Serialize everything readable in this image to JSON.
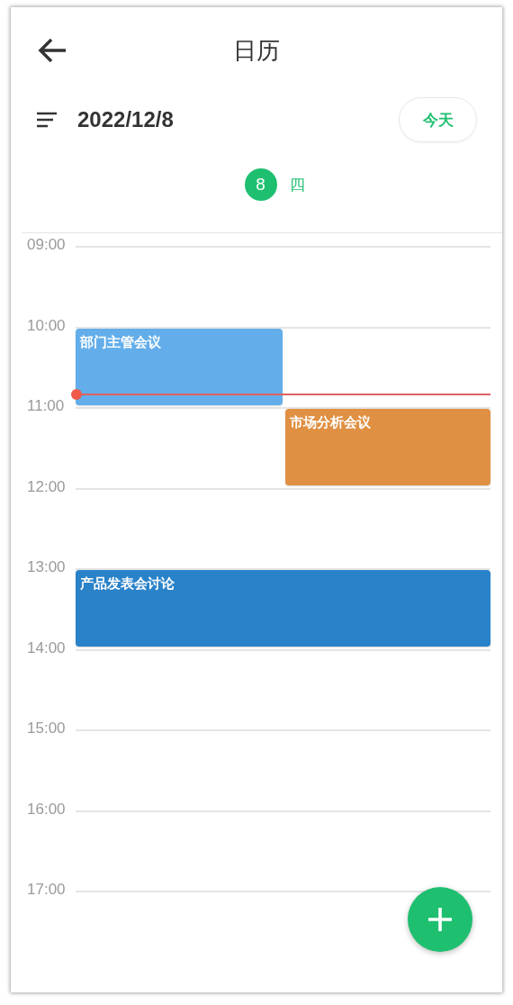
{
  "header": {
    "title": "日历"
  },
  "toolbar": {
    "date": "2022/12/8",
    "today_button": "今天"
  },
  "day": {
    "number": "8",
    "weekday": "四",
    "selected": true
  },
  "hours": [
    {
      "label": "09:00",
      "now": false
    },
    {
      "label": "10:00",
      "now": true,
      "events": [
        {
          "title": "部门主管会议",
          "color": "#63aeea"
        }
      ]
    },
    {
      "label": "11:00",
      "now": false,
      "events": [
        {
          "title": "市场分析会议",
          "color": "#e09043"
        }
      ]
    },
    {
      "label": "12:00",
      "now": false
    },
    {
      "label": "13:00",
      "now": false,
      "events": [
        {
          "title": "产品发表会讨论",
          "color": "#2a82c9"
        }
      ]
    },
    {
      "label": "14:00",
      "now": false
    },
    {
      "label": "15:00",
      "now": false
    },
    {
      "label": "16:00",
      "now": false
    },
    {
      "label": "17:00",
      "now": false
    }
  ]
}
